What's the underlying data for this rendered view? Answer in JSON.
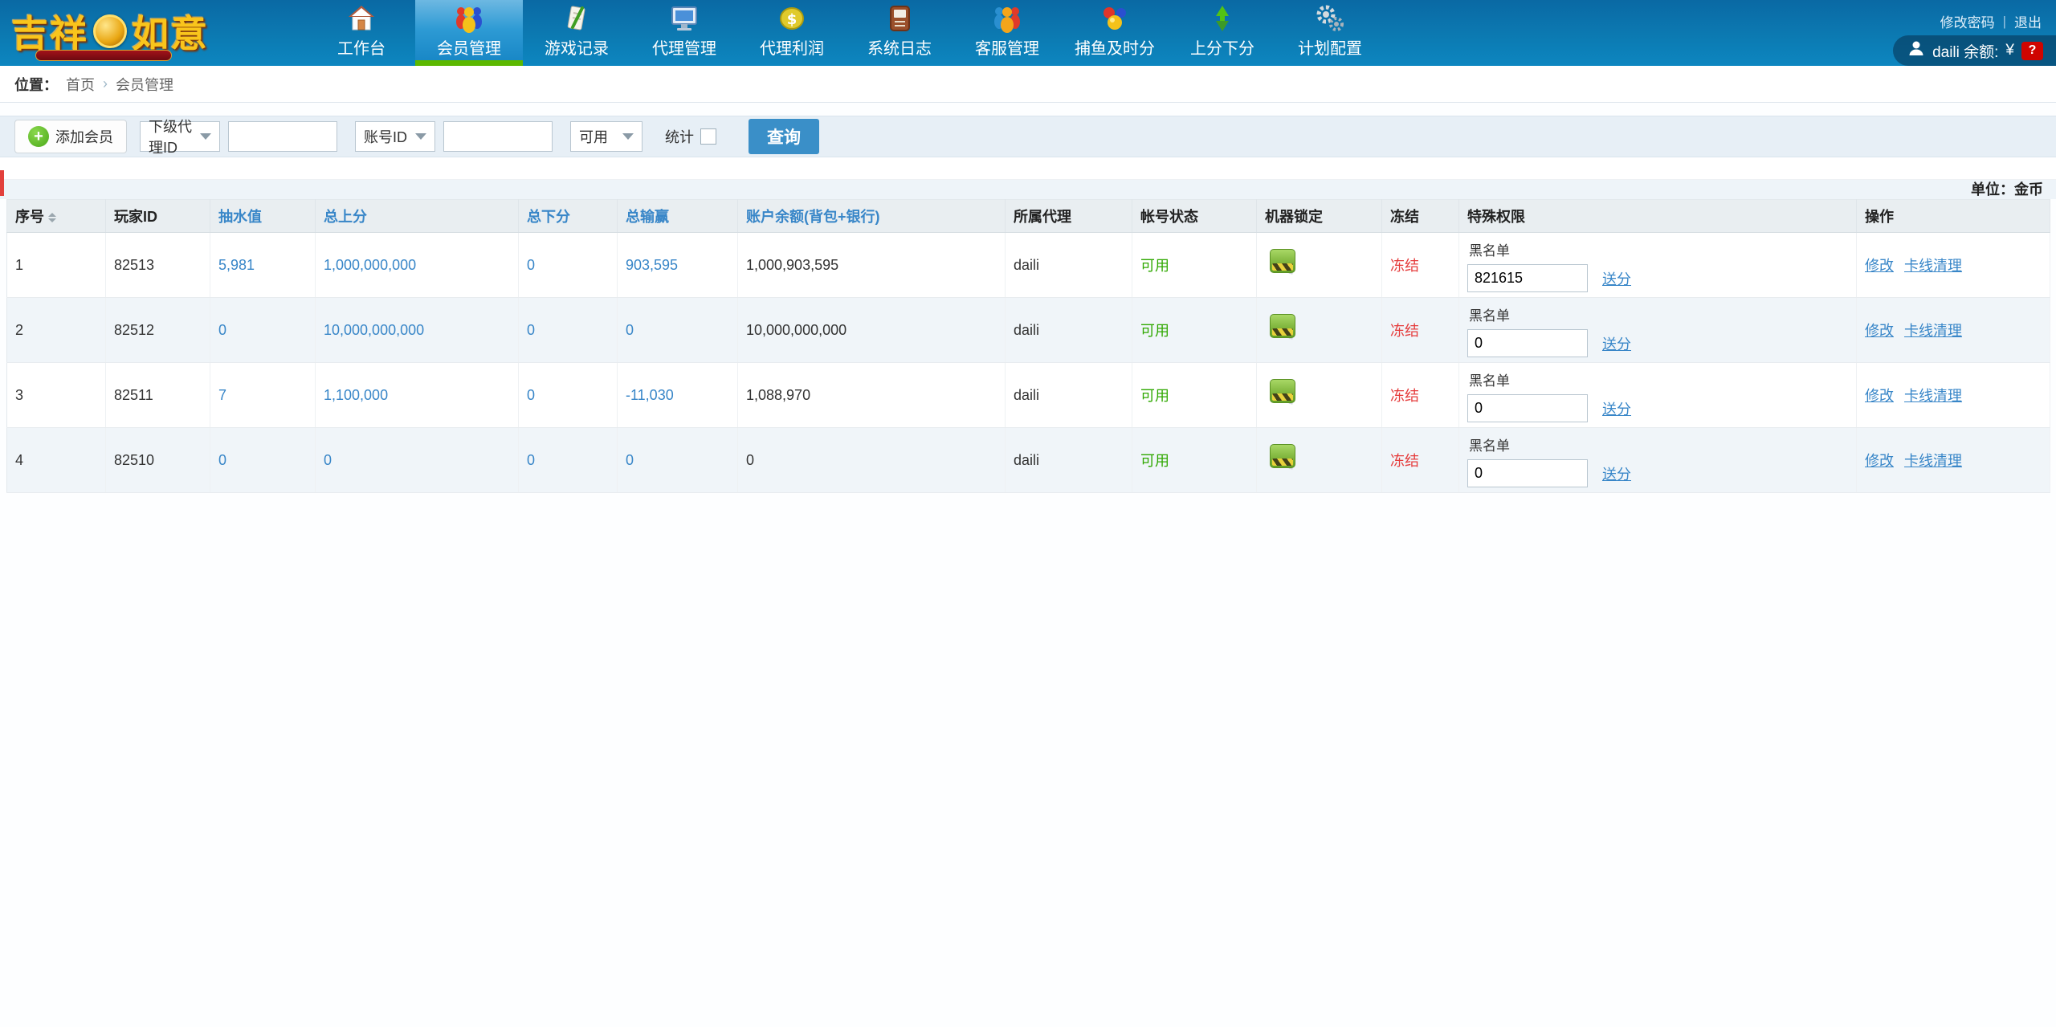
{
  "header": {
    "logo": {
      "left": "吉祥",
      "right": "如意"
    },
    "top_links": {
      "change_password": "修改密码",
      "divider": "|",
      "logout": "退出"
    },
    "user_pill": {
      "name_and_balance": "daili 余额:",
      "currency": "¥",
      "badge": "?"
    },
    "nav": {
      "items": [
        {
          "label": "工作台"
        },
        {
          "label": "会员管理"
        },
        {
          "label": "游戏记录"
        },
        {
          "label": "代理管理"
        },
        {
          "label": "代理利润"
        },
        {
          "label": "系统日志"
        },
        {
          "label": "客服管理"
        },
        {
          "label": "捕鱼及时分"
        },
        {
          "label": "上分下分"
        },
        {
          "label": "计划配置"
        }
      ]
    }
  },
  "breadcrumb": {
    "label": "位置：",
    "home": "首页",
    "separator": "›",
    "current": "会员管理"
  },
  "filterbar": {
    "add_member_label": "添加会员",
    "agent_select_value": "下级代理ID",
    "account_select_value": "账号ID",
    "status_select_value": "可用",
    "stats_label": "统计",
    "search_label": "查询",
    "agent_id_input_value": "",
    "account_input_value": ""
  },
  "unit_label": "单位：金币",
  "table": {
    "headers": {
      "index": "序号",
      "player_id": "玩家ID",
      "rake": "抽水值",
      "total_up": "总上分",
      "total_down": "总下分",
      "total_winloss": "总输赢",
      "balance": "账户余额(背包+银行)",
      "agent": "所属代理",
      "account_status": "帐号状态",
      "machine_lock": "机器锁定",
      "freeze": "冻结",
      "special_rights": "特殊权限",
      "actions": "操作"
    },
    "blacklist_label": "黑名单",
    "send_points_label": "送分",
    "action_edit": "修改",
    "action_clear": "卡线清理",
    "rows": [
      {
        "index": "1",
        "player_id": "82513",
        "rake": "5,981",
        "total_up": "1,000,000,000",
        "total_down": "0",
        "total_winloss": "903,595",
        "balance": "1,000,903,595",
        "agent": "daili",
        "status": "可用",
        "freeze": "冻结",
        "blacklist_value": "821615"
      },
      {
        "index": "2",
        "player_id": "82512",
        "rake": "0",
        "total_up": "10,000,000,000",
        "total_down": "0",
        "total_winloss": "0",
        "balance": "10,000,000,000",
        "agent": "daili",
        "status": "可用",
        "freeze": "冻结",
        "blacklist_value": "0"
      },
      {
        "index": "3",
        "player_id": "82511",
        "rake": "7",
        "total_up": "1,100,000",
        "total_down": "0",
        "total_winloss": "-11,030",
        "balance": "1,088,970",
        "agent": "daili",
        "status": "可用",
        "freeze": "冻结",
        "blacklist_value": "0"
      },
      {
        "index": "4",
        "player_id": "82510",
        "rake": "0",
        "total_up": "0",
        "total_down": "0",
        "total_winloss": "0",
        "balance": "0",
        "agent": "daili",
        "status": "可用",
        "freeze": "冻结",
        "blacklist_value": "0"
      }
    ]
  },
  "colors": {
    "nav_blue_top": "#0a69a4",
    "nav_blue_bottom": "#0d86c0",
    "active_tab_green": "#5cb800",
    "link_blue": "#3886c8",
    "status_green": "#2fa800",
    "freeze_red": "#e53c3c",
    "search_button_blue": "#3a8fc8",
    "badge_red": "#cf0400"
  }
}
